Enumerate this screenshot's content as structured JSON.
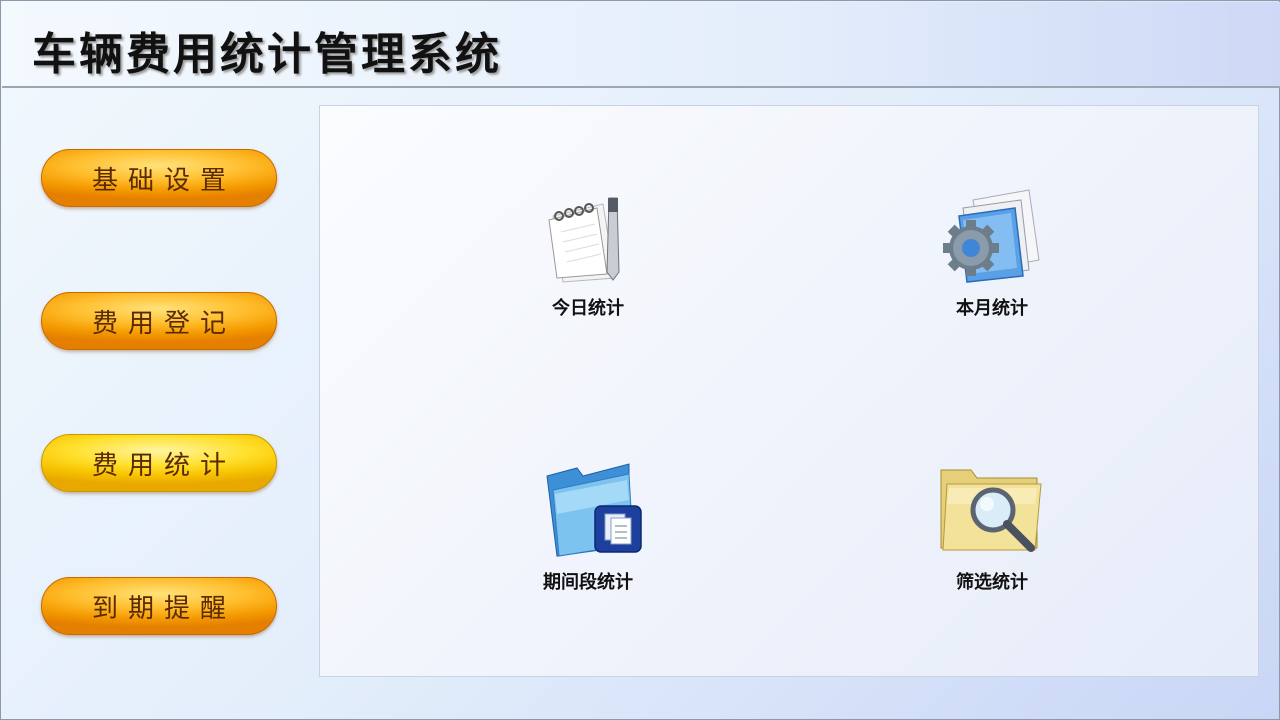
{
  "app": {
    "title": "车辆费用统计管理系统"
  },
  "nav": {
    "items": [
      {
        "label": "基础设置"
      },
      {
        "label": "费用登记"
      },
      {
        "label": "费用统计"
      },
      {
        "label": "到期提醒"
      }
    ]
  },
  "main": {
    "tiles": [
      {
        "label": "今日统计",
        "icon": "notepad-pen-icon"
      },
      {
        "label": "本月统计",
        "icon": "gear-documents-icon"
      },
      {
        "label": "期间段统计",
        "icon": "blue-folder-icon"
      },
      {
        "label": "筛选统计",
        "icon": "folder-search-icon"
      }
    ]
  },
  "colors": {
    "nav_orange": "#f49a00",
    "nav_yellow": "#ffe02c",
    "title_text": "#111111"
  }
}
